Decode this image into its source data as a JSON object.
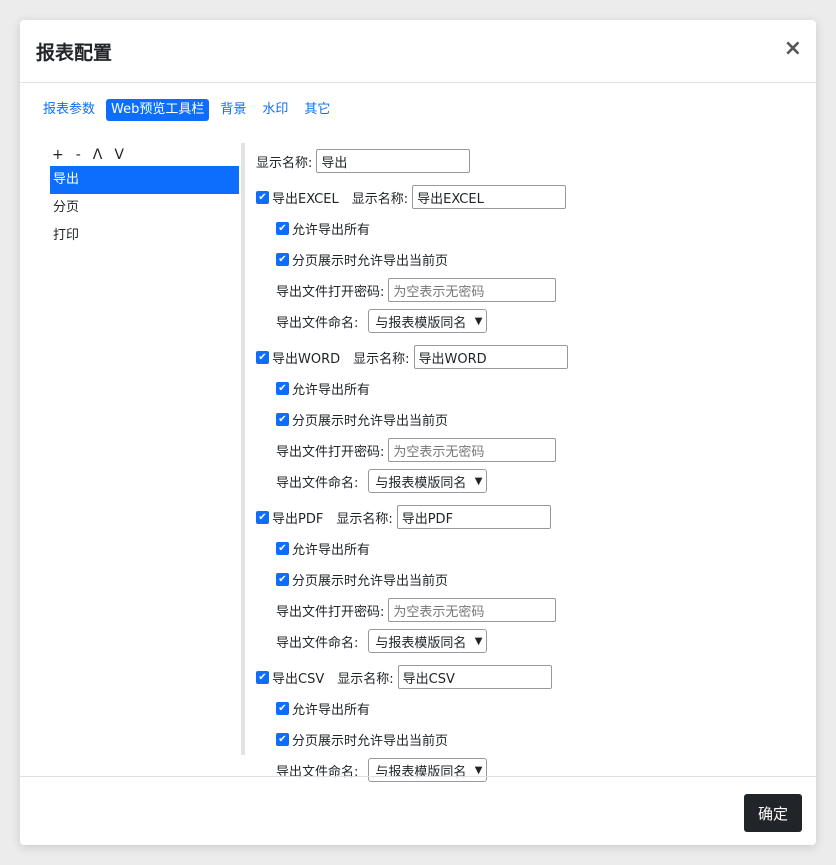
{
  "dialog": {
    "title": "报表配置",
    "close": "×",
    "ok_label": "确定"
  },
  "tabs": [
    "报表参数",
    "Web预览工具栏",
    "背景",
    "水印",
    "其它"
  ],
  "toolbar_buttons": [
    "+",
    "-",
    "Λ",
    "V"
  ],
  "list_items": [
    "导出",
    "分页",
    "打印"
  ],
  "detail": {
    "name_label": "显示名称:",
    "name_value": "导出",
    "excel": {
      "check_label": "导出EXCEL",
      "name_label": "显示名称:",
      "name_value": "导出EXCEL",
      "allow_all": "允许导出所有",
      "allow_page": "分页展示时允许导出当前页",
      "pwd_label": "导出文件打开密码:",
      "pwd_placeholder": "为空表示无密码",
      "naming_label": "导出文件命名:",
      "naming_value": "与报表模版同名"
    },
    "word": {
      "check_label": "导出WORD",
      "name_label": "显示名称:",
      "name_value": "导出WORD",
      "allow_all": "允许导出所有",
      "allow_page": "分页展示时允许导出当前页",
      "pwd_label": "导出文件打开密码:",
      "pwd_placeholder": "为空表示无密码",
      "naming_label": "导出文件命名:",
      "naming_value": "与报表模版同名"
    },
    "pdf": {
      "check_label": "导出PDF",
      "name_label": "显示名称:",
      "name_value": "导出PDF",
      "allow_all": "允许导出所有",
      "allow_page": "分页展示时允许导出当前页",
      "pwd_label": "导出文件打开密码:",
      "pwd_placeholder": "为空表示无密码",
      "naming_label": "导出文件命名:",
      "naming_value": "与报表模版同名"
    },
    "csv": {
      "check_label": "导出CSV",
      "name_label": "显示名称:",
      "name_value": "导出CSV",
      "allow_all": "允许导出所有",
      "allow_page": "分页展示时允许导出当前页",
      "naming_label": "导出文件命名:",
      "naming_value": "与报表模版同名"
    }
  },
  "colors": {
    "accent": "#0d6efd",
    "dark_button": "#212529"
  },
  "icons": {
    "check": "checkmark-icon",
    "close": "close-icon",
    "dropdown": "chevron-down-icon"
  }
}
